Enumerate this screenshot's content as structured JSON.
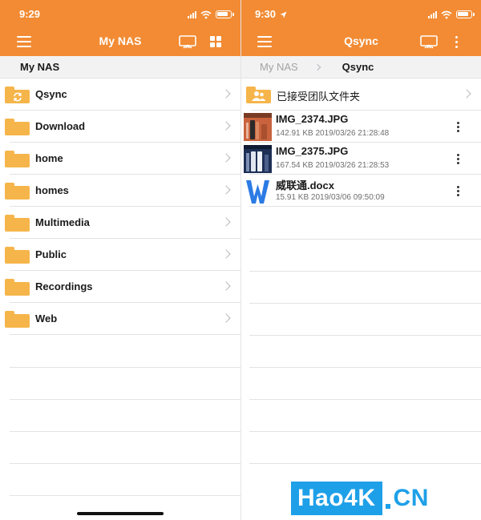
{
  "colors": {
    "accent": "#f28b33",
    "folder": "#f6b54a",
    "watermark": "#1ea0e8"
  },
  "left": {
    "status": {
      "time": "9:29"
    },
    "navbar": {
      "title": "My NAS",
      "left_icon": "menu-icon",
      "right_icons": [
        "cast-icon",
        "grid-view-icon"
      ]
    },
    "breadcrumb": {
      "current": "My NAS"
    },
    "folders": [
      {
        "label": "Qsync",
        "icon": "qsync-folder-icon"
      },
      {
        "label": "Download",
        "icon": "folder-icon"
      },
      {
        "label": "home",
        "icon": "folder-icon"
      },
      {
        "label": "homes",
        "icon": "folder-icon"
      },
      {
        "label": "Multimedia",
        "icon": "folder-icon"
      },
      {
        "label": "Public",
        "icon": "folder-icon"
      },
      {
        "label": "Recordings",
        "icon": "folder-icon"
      },
      {
        "label": "Web",
        "icon": "folder-icon"
      }
    ]
  },
  "right": {
    "status": {
      "time": "9:30"
    },
    "navbar": {
      "title": "Qsync",
      "left_icon": "menu-icon",
      "right_icons": [
        "cast-icon",
        "more-vertical-icon"
      ]
    },
    "breadcrumb": {
      "parent": "My NAS",
      "current": "Qsync"
    },
    "shared_folder": {
      "label": "已接受团队文件夹",
      "icon": "team-folder-icon"
    },
    "files": [
      {
        "name": "IMG_2374.JPG",
        "size": "142.91 KB",
        "date": "2019/03/26 21:28:48",
        "meta": "142.91 KB 2019/03/26 21:28:48",
        "icon": "image-thumbnail"
      },
      {
        "name": "IMG_2375.JPG",
        "size": "167.54 KB",
        "date": "2019/03/26 21:28:53",
        "meta": "167.54 KB 2019/03/26 21:28:53",
        "icon": "image-thumbnail"
      },
      {
        "name": "威联通.docx",
        "size": "15.91 KB",
        "date": "2019/03/06 09:50:09",
        "meta": "15.91 KB 2019/03/06 09:50:09",
        "icon": "word-doc-icon"
      }
    ]
  },
  "watermark": {
    "box_text": "Hao4K",
    "text": "CN"
  }
}
